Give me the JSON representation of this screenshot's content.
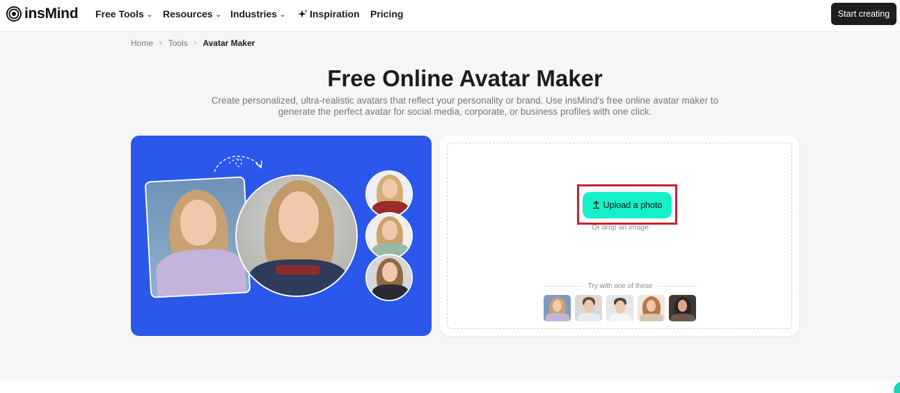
{
  "nav": {
    "logo": "insMind",
    "items": [
      {
        "label": "Free Tools",
        "has_dropdown": true
      },
      {
        "label": "Resources",
        "has_dropdown": true
      },
      {
        "label": "Industries",
        "has_dropdown": true
      },
      {
        "label": "Inspiration",
        "has_dropdown": false
      },
      {
        "label": "Pricing",
        "has_dropdown": false
      }
    ],
    "cta": "Start creating"
  },
  "breadcrumb": [
    "Home",
    "Tools",
    "Avatar Maker"
  ],
  "hero": {
    "title": "Free Online Avatar Maker",
    "subtitle_line1": "Create personalized, ultra-realistic avatars that reflect your personality or brand. Use insMind's free online avatar maker to",
    "subtitle_line2": "generate the perfect avatar for social media, corporate, or business profiles with one click."
  },
  "upload": {
    "button": "Upload a photo",
    "hint": "Or drop an image",
    "try_label": "Try with one of these",
    "samples": [
      "sample-1",
      "sample-2",
      "sample-3",
      "sample-4",
      "sample-5"
    ]
  },
  "colors": {
    "showcase_bg": "#2b57ea",
    "upload_button": "#15f0c8",
    "cta_bg": "#1e1e1e",
    "highlight": "#c8202a"
  }
}
